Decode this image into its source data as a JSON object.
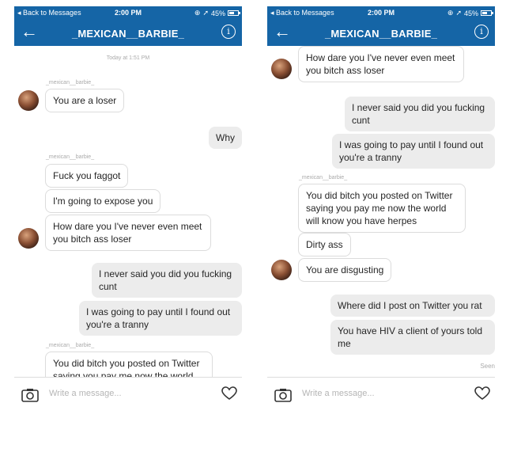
{
  "status_bar": {
    "back": "Back to Messages",
    "time": "2:00 PM",
    "battery": "45%"
  },
  "header": {
    "title": "_MEXICAN__BARBIE_",
    "back_icon": "arrow-left-icon",
    "info_icon": "info-icon"
  },
  "composer": {
    "placeholder": "Write a message...",
    "camera_icon": "camera-icon",
    "heart_icon": "heart-icon"
  },
  "left": {
    "date": "Today at 1:51 PM",
    "sender1": "_mexican__barbie_",
    "m1": "You are a loser",
    "m2": "Why",
    "sender2": "_mexican__barbie_",
    "m3": "Fuck you faggot",
    "m4": "I'm going to expose you",
    "m5": "How dare you I've never even meet you bitch ass loser",
    "m6": "I never said you did you fucking cunt",
    "m7": "I was going to pay until I found out you're a tranny",
    "sender3": "_mexican__barbie_",
    "m8": "You did bitch you posted on Twitter saying you pay me now the world"
  },
  "right": {
    "m1": "How dare you I've never even meet you bitch ass loser",
    "m2": "I never said you did you fucking cunt",
    "m3": "I was going to pay until I found out you're a tranny",
    "sender1": "_mexican__barbie_",
    "m4": "You did bitch you posted on Twitter saying you pay me now the world will know you have herpes",
    "m5": "Dirty ass",
    "m6": "You are disgusting",
    "m7": "Where did I post on Twitter you rat",
    "m8": "You have HIV a client of yours told me",
    "seen": "Seen"
  }
}
